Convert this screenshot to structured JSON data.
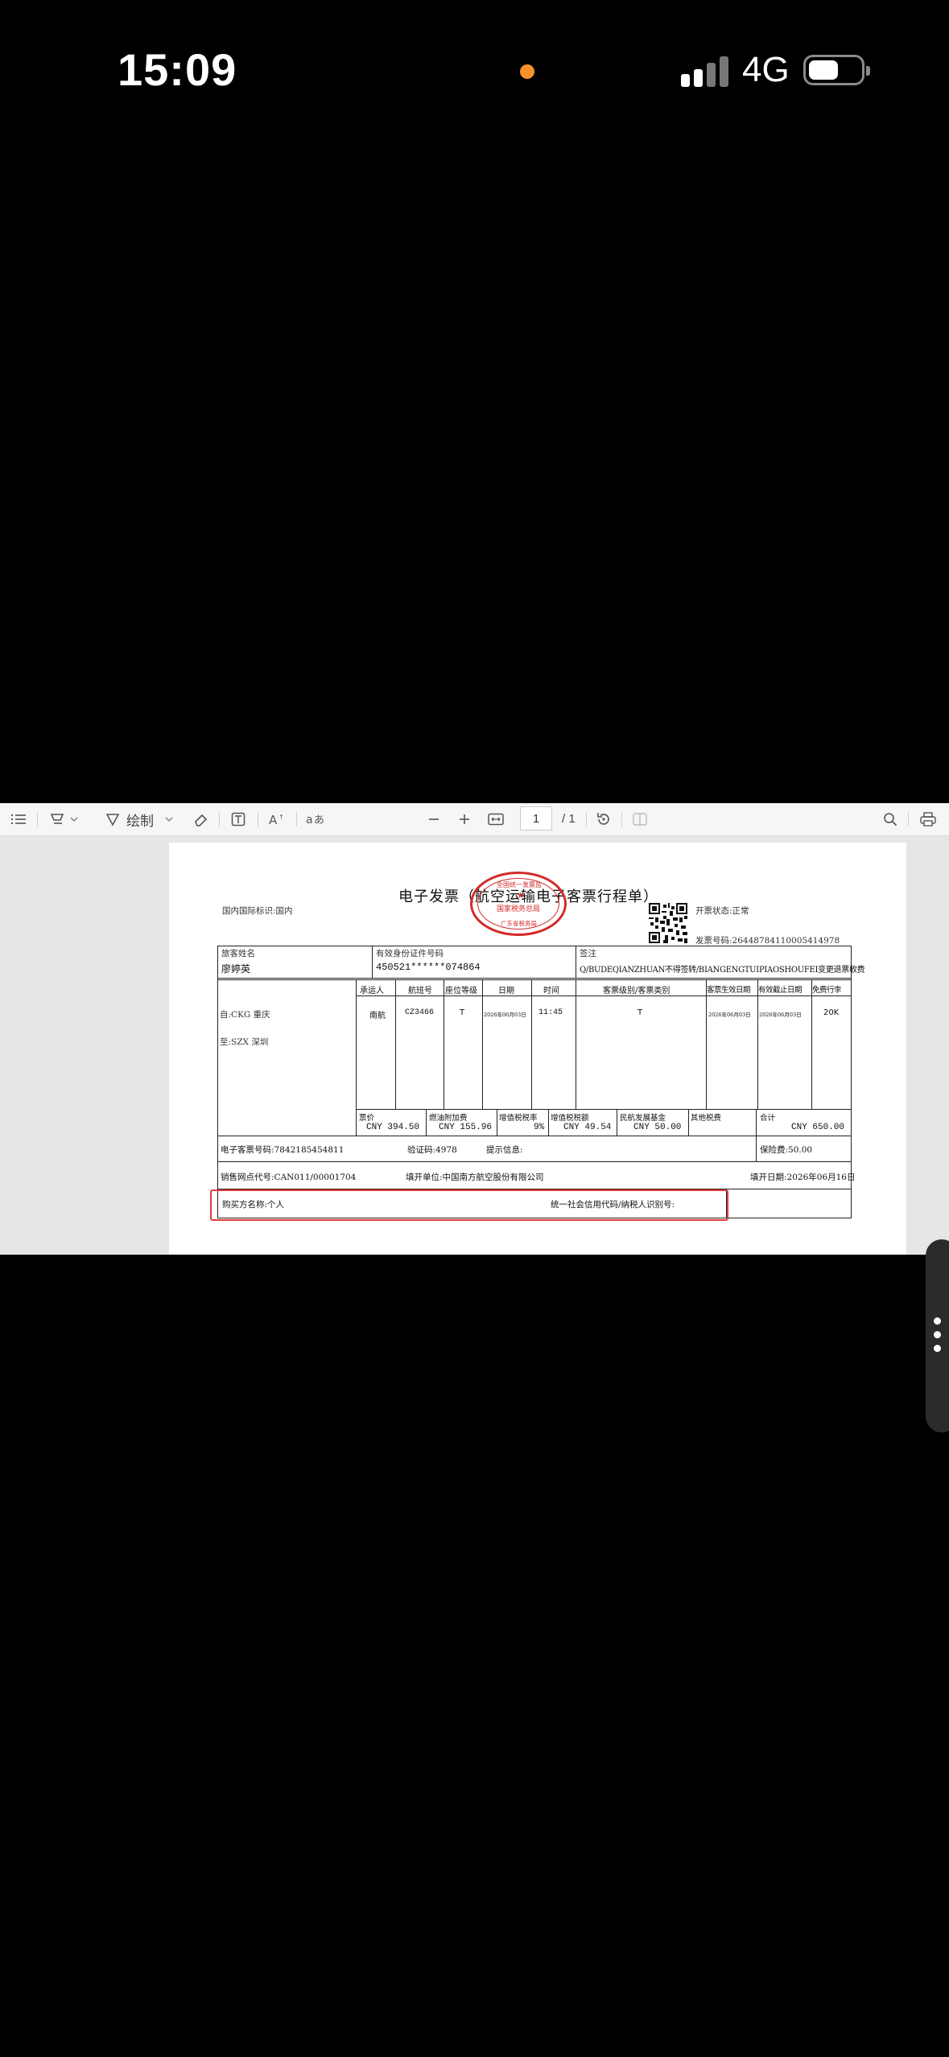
{
  "status_bar": {
    "time": "15:09",
    "network": "4G"
  },
  "toolbar": {
    "draw_label": "绘制",
    "current_page": "1",
    "total_pages": "/ 1"
  },
  "invoice": {
    "title": "电子发票（航空运输电子客票行程单）",
    "domestic_flag": "国内国际标识:国内",
    "issue_status": "开票状态:正常",
    "invoice_number": "发票号码:26448784110005414978",
    "stamp": {
      "top": "全国统一发票监",
      "middle": "国家税务总局",
      "bottom": "广东省税务局"
    },
    "passenger_label": "旅客姓名",
    "passenger_name": "廖婷英",
    "id_label": "有效身份证件号码",
    "id_value": "450521******074864",
    "endorse_label": "签注",
    "endorse_value": "Q/BUDEQIANZHUAN不得签转/BIANGENGTUIPIAOSHOUFEI变更退票收费",
    "columns": [
      "承运人",
      "航班号",
      "座位等级",
      "日期",
      "时间",
      "客票级别/客票类别",
      "客票生效日期",
      "有效截止日期",
      "免费行李"
    ],
    "from": "自:CKG 重庆",
    "to": "至:SZX 深圳",
    "flight": {
      "carrier": "南航",
      "flight_no": "CZ3466",
      "seat_class": "T",
      "date": "2026年06月03日",
      "time": "11:45",
      "fare_basis": "T",
      "valid_from": "2026年06月03日",
      "valid_until": "2026年06月03日",
      "baggage": "20K"
    },
    "fees": [
      {
        "label": "票价",
        "value": "CNY 394.50"
      },
      {
        "label": "燃油附加费",
        "value": "CNY 155.96"
      },
      {
        "label": "增值税税率",
        "value": "9%"
      },
      {
        "label": "增值税税额",
        "value": "CNY 49.54"
      },
      {
        "label": "民航发展基金",
        "value": "CNY 50.00"
      },
      {
        "label": "其他税费",
        "value": ""
      },
      {
        "label": "合计",
        "value": "CNY 650.00"
      }
    ],
    "eticket": "电子客票号码:7842185454811",
    "verification": "验证码:4978",
    "notice": "提示信息:",
    "insurance": "保险费:50.00",
    "agent": "销售网点代号:CAN011/00001704",
    "issuer": "填开单位:中国南方航空股份有限公司",
    "issue_date": "填开日期:2026年06月16日",
    "buyer": "购买方名称:个人",
    "tax_id": "统一社会信用代码/纳税人识别号:"
  }
}
